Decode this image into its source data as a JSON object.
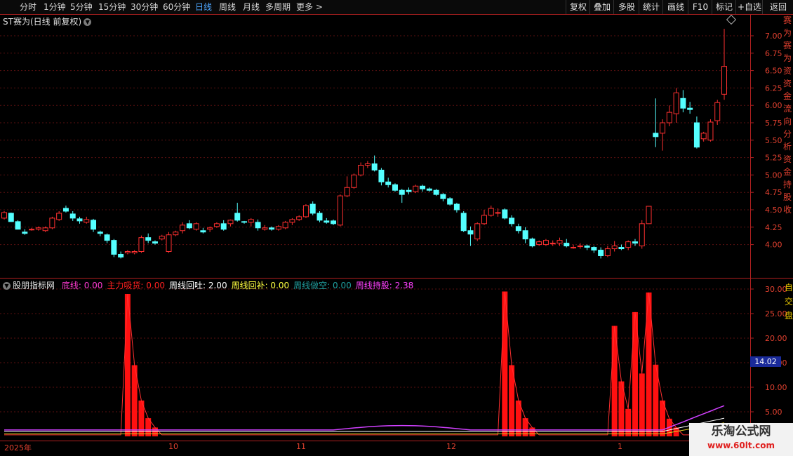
{
  "toolbar": {
    "periods": [
      "分时",
      "1分钟",
      "5分钟",
      "15分钟",
      "30分钟",
      "60分钟",
      "日线",
      "周线",
      "月线",
      "多周期",
      "更多 >"
    ],
    "active_period": "日线",
    "right_buttons": [
      "复权",
      "叠加",
      "多股",
      "统计",
      "画线",
      "F10",
      "标记",
      "+自选",
      "返回"
    ]
  },
  "main_chart": {
    "title": "ST赛为(日线 前复权)"
  },
  "indicator": {
    "name": "股朋指标网",
    "items": [
      {
        "label": "底线: 0.00",
        "color": "#ff3ad1"
      },
      {
        "label": "主力吸货: 0.00",
        "color": "#ff2020"
      },
      {
        "label": "周线回吐: 2.00",
        "color": "#ffffff"
      },
      {
        "label": "周线回补: 0.00",
        "color": "#ffff40"
      },
      {
        "label": "周线做空: 0.00",
        "color": "#20a0a0"
      },
      {
        "label": "周线持股: 2.38",
        "color": "#ff40ff"
      }
    ],
    "current_value": "14.02"
  },
  "right_strip_chars": [
    "赛",
    "为",
    "赛",
    "为",
    "资",
    "资",
    "金",
    "流",
    "向",
    "分",
    "析",
    "资",
    "金",
    "持",
    "股",
    "收"
  ],
  "right_strip2_chars": [
    "自",
    "交",
    "盘"
  ],
  "dates": [
    "2025年",
    "10",
    "11",
    "12",
    "1"
  ],
  "watermark": {
    "line1": "乐淘公式网",
    "line2": "www.60lt.com"
  },
  "chart_data": [
    {
      "type": "candlestick",
      "title": "ST赛为(日线 前复权)",
      "y_ticks": [
        "7.00",
        "6.75",
        "6.50",
        "6.25",
        "6.00",
        "5.75",
        "5.50",
        "5.25",
        "5.00",
        "4.75",
        "4.50",
        "4.25",
        "4.00"
      ],
      "ylim": [
        3.75,
        7.1
      ],
      "up_color": "#ff3030",
      "down_color": "#54ffff",
      "candles": [
        [
          4.38,
          4.48,
          4.46,
          4.36
        ],
        [
          4.45,
          4.46,
          4.33,
          4.33
        ],
        [
          4.33,
          4.35,
          4.22,
          4.22
        ],
        [
          4.18,
          4.22,
          4.16,
          4.14
        ],
        [
          4.22,
          4.24,
          4.22,
          4.2
        ],
        [
          4.22,
          4.26,
          4.24,
          4.2
        ],
        [
          4.2,
          4.26,
          4.24,
          4.18
        ],
        [
          4.24,
          4.4,
          4.38,
          4.22
        ],
        [
          4.36,
          4.48,
          4.45,
          4.34
        ],
        [
          4.52,
          4.56,
          4.48,
          4.46
        ],
        [
          4.44,
          4.48,
          4.38,
          4.34
        ],
        [
          4.37,
          4.4,
          4.34,
          4.3
        ],
        [
          4.32,
          4.4,
          4.36,
          4.3
        ],
        [
          4.35,
          4.37,
          4.22,
          4.18
        ],
        [
          4.18,
          4.2,
          4.16,
          4.12
        ],
        [
          4.14,
          4.16,
          4.06,
          4.02
        ],
        [
          4.06,
          4.08,
          3.86,
          3.82
        ],
        [
          3.86,
          3.9,
          3.82,
          3.8
        ],
        [
          3.88,
          3.92,
          3.9,
          3.86
        ],
        [
          3.88,
          3.92,
          3.9,
          3.86
        ],
        [
          3.9,
          4.13,
          4.1,
          3.88
        ],
        [
          4.1,
          4.16,
          4.06,
          4.02
        ],
        [
          4.04,
          4.06,
          4.02,
          4.0
        ],
        [
          4.08,
          4.14,
          4.12,
          4.06
        ],
        [
          3.9,
          4.18,
          4.14,
          3.88
        ],
        [
          4.14,
          4.2,
          4.18,
          4.12
        ],
        [
          4.2,
          4.32,
          4.28,
          4.16
        ],
        [
          4.3,
          4.35,
          4.24,
          4.22
        ],
        [
          4.22,
          4.32,
          4.3,
          4.2
        ],
        [
          4.2,
          4.24,
          4.18,
          4.16
        ],
        [
          4.22,
          4.26,
          4.24,
          4.18
        ],
        [
          4.26,
          4.32,
          4.3,
          4.24
        ],
        [
          4.3,
          4.35,
          4.22,
          4.2
        ],
        [
          4.3,
          4.36,
          4.35,
          4.26
        ],
        [
          4.45,
          4.6,
          4.35,
          4.33
        ],
        [
          4.33,
          4.34,
          4.32,
          4.3
        ],
        [
          4.32,
          4.38,
          4.36,
          4.26
        ],
        [
          4.32,
          4.36,
          4.24,
          4.2
        ],
        [
          4.22,
          4.28,
          4.24,
          4.2
        ],
        [
          4.24,
          4.26,
          4.22,
          4.2
        ],
        [
          4.22,
          4.28,
          4.26,
          4.2
        ],
        [
          4.24,
          4.34,
          4.32,
          4.22
        ],
        [
          4.32,
          4.38,
          4.36,
          4.28
        ],
        [
          4.36,
          4.42,
          4.4,
          4.34
        ],
        [
          4.4,
          4.58,
          4.56,
          4.38
        ],
        [
          4.58,
          4.62,
          4.45,
          4.42
        ],
        [
          4.45,
          4.48,
          4.35,
          4.32
        ],
        [
          4.34,
          4.38,
          4.32,
          4.3
        ],
        [
          4.34,
          4.36,
          4.3,
          4.28
        ],
        [
          4.28,
          4.72,
          4.7,
          4.26
        ],
        [
          4.7,
          4.98,
          4.82,
          4.68
        ],
        [
          4.82,
          5.02,
          5.0,
          4.8
        ],
        [
          5.0,
          5.18,
          5.14,
          4.98
        ],
        [
          5.14,
          5.2,
          5.16,
          5.1
        ],
        [
          5.16,
          5.28,
          5.07,
          5.05
        ],
        [
          5.07,
          5.1,
          4.9,
          4.85
        ],
        [
          4.9,
          4.96,
          4.86,
          4.82
        ],
        [
          4.86,
          4.88,
          4.78,
          4.76
        ],
        [
          4.78,
          4.8,
          4.72,
          4.6
        ],
        [
          4.78,
          4.82,
          4.76,
          4.72
        ],
        [
          4.76,
          4.86,
          4.84,
          4.74
        ],
        [
          4.84,
          4.86,
          4.8,
          4.76
        ],
        [
          4.8,
          4.82,
          4.78,
          4.76
        ],
        [
          4.78,
          4.8,
          4.72,
          4.7
        ],
        [
          4.72,
          4.74,
          4.66,
          4.62
        ],
        [
          4.66,
          4.68,
          4.58,
          4.56
        ],
        [
          4.58,
          4.6,
          4.5,
          4.46
        ],
        [
          4.45,
          4.48,
          4.2,
          4.18
        ],
        [
          4.2,
          4.26,
          4.15,
          3.98
        ],
        [
          4.08,
          4.32,
          4.3,
          4.05
        ],
        [
          4.3,
          4.5,
          4.42,
          4.28
        ],
        [
          4.42,
          4.56,
          4.52,
          4.4
        ],
        [
          4.46,
          4.52,
          4.46,
          4.4
        ],
        [
          4.5,
          4.52,
          4.38,
          4.36
        ],
        [
          4.38,
          4.42,
          4.3,
          4.26
        ],
        [
          4.26,
          4.3,
          4.2,
          4.16
        ],
        [
          4.2,
          4.25,
          4.08,
          4.02
        ],
        [
          4.08,
          4.1,
          3.98,
          3.96
        ],
        [
          4.0,
          4.06,
          4.04,
          3.98
        ],
        [
          4.0,
          4.08,
          4.06,
          3.98
        ],
        [
          4.02,
          4.06,
          4.02,
          3.98
        ],
        [
          4.02,
          4.1,
          4.06,
          3.98
        ],
        [
          4.02,
          4.08,
          3.98,
          3.96
        ],
        [
          3.96,
          4.0,
          3.96,
          3.94
        ],
        [
          3.98,
          4.02,
          3.98,
          3.94
        ],
        [
          3.98,
          4.0,
          3.96,
          3.92
        ],
        [
          3.96,
          3.98,
          3.92,
          3.88
        ],
        [
          3.92,
          3.96,
          3.84,
          3.8
        ],
        [
          3.84,
          3.98,
          3.94,
          3.82
        ],
        [
          3.94,
          4.05,
          3.98,
          3.9
        ],
        [
          3.96,
          4.0,
          3.94,
          3.92
        ],
        [
          3.96,
          4.06,
          4.04,
          3.92
        ],
        [
          4.04,
          4.08,
          4.02,
          3.98
        ],
        [
          3.98,
          4.35,
          4.3,
          3.94
        ],
        [
          4.3,
          4.2,
          4.55,
          5.2
        ],
        [
          5.6,
          6.1,
          5.55,
          5.4
        ],
        [
          5.6,
          5.8,
          5.75,
          5.35
        ],
        [
          5.75,
          6.0,
          5.9,
          5.7
        ],
        [
          5.88,
          6.25,
          6.18,
          5.75
        ],
        [
          6.1,
          6.22,
          5.96,
          5.9
        ],
        [
          5.96,
          6.05,
          5.94,
          5.88
        ],
        [
          5.75,
          5.84,
          5.4,
          5.38
        ],
        [
          5.52,
          5.62,
          5.6,
          5.48
        ],
        [
          5.5,
          5.8,
          5.76,
          5.48
        ],
        [
          5.78,
          6.08,
          6.04,
          5.72
        ],
        [
          6.16,
          7.1,
          6.56,
          6.08
        ]
      ]
    },
    {
      "type": "bar+line",
      "title": "股朋指标网",
      "y_ticks": [
        "30.00",
        "25.00",
        "20.00",
        "15.00",
        "10.00",
        "5.00"
      ],
      "ylim": [
        0,
        31
      ],
      "bar_series_name": "主力吸货",
      "bars": [
        {
          "i": 18,
          "v": 29
        },
        {
          "i": 19,
          "v": 14.5
        },
        {
          "i": 20,
          "v": 7.3
        },
        {
          "i": 21,
          "v": 3.7
        },
        {
          "i": 22,
          "v": 1.8
        },
        {
          "i": 73,
          "v": 29.5
        },
        {
          "i": 74,
          "v": 14.5
        },
        {
          "i": 75,
          "v": 7.3
        },
        {
          "i": 76,
          "v": 3.7
        },
        {
          "i": 77,
          "v": 1.8
        },
        {
          "i": 89,
          "v": 22.5
        },
        {
          "i": 90,
          "v": 11.2
        },
        {
          "i": 91,
          "v": 5.6
        },
        {
          "i": 92,
          "v": 25.3
        },
        {
          "i": 93,
          "v": 12.8
        },
        {
          "i": 94,
          "v": 29.3
        },
        {
          "i": 95,
          "v": 14.6
        },
        {
          "i": 96,
          "v": 7.3
        },
        {
          "i": 97,
          "v": 3.6
        },
        {
          "i": 98,
          "v": 1.8
        }
      ]
    }
  ]
}
